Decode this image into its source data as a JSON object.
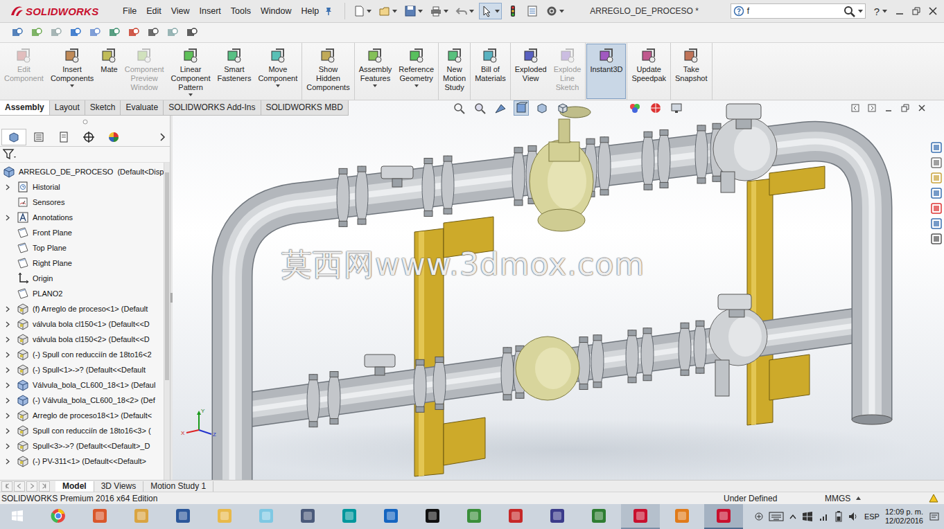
{
  "app": {
    "logo": "SOLIDWORKS",
    "title": "ARREGLO_DE_PROCESO *",
    "search_value": "f",
    "help": "?"
  },
  "menu": [
    "File",
    "Edit",
    "View",
    "Insert",
    "Tools",
    "Window",
    "Help"
  ],
  "quick_access_tools": [
    {
      "selected": false,
      "dropdown": true
    },
    {
      "selected": false,
      "dropdown": true
    },
    {
      "selected": false,
      "dropdown": true
    },
    {
      "selected": false,
      "dropdown": true
    },
    {
      "selected": false,
      "dropdown": true
    },
    {
      "selected": true,
      "dropdown": true
    },
    {
      "selected": false,
      "dropdown": false
    },
    {
      "selected": false,
      "dropdown": false
    },
    {
      "selected": false,
      "dropdown": true
    }
  ],
  "command_groups": [
    [
      {
        "lines": [
          "Edit",
          "Component"
        ],
        "disabled": true,
        "dropdown": false,
        "selected": false
      },
      {
        "lines": [
          "Insert",
          "Components"
        ],
        "disabled": false,
        "dropdown": true,
        "selected": false
      },
      {
        "lines": [
          "Mate"
        ],
        "disabled": false,
        "dropdown": false,
        "selected": false
      },
      {
        "lines": [
          "Component",
          "Preview",
          "Window"
        ],
        "disabled": true,
        "dropdown": false,
        "selected": false
      },
      {
        "lines": [
          "Linear",
          "Component",
          "Pattern"
        ],
        "disabled": false,
        "dropdown": true,
        "selected": false
      },
      {
        "lines": [
          "Smart",
          "Fasteners"
        ],
        "disabled": false,
        "dropdown": false,
        "selected": false
      },
      {
        "lines": [
          "Move",
          "Component"
        ],
        "disabled": false,
        "dropdown": true,
        "selected": false
      }
    ],
    [
      {
        "lines": [
          "Show",
          "Hidden",
          "Components"
        ],
        "disabled": false,
        "dropdown": false,
        "selected": false
      }
    ],
    [
      {
        "lines": [
          "Assembly",
          "Features"
        ],
        "disabled": false,
        "dropdown": true,
        "selected": false
      },
      {
        "lines": [
          "Reference",
          "Geometry"
        ],
        "disabled": false,
        "dropdown": true,
        "selected": false
      }
    ],
    [
      {
        "lines": [
          "New",
          "Motion",
          "Study"
        ],
        "disabled": false,
        "dropdown": false,
        "selected": false
      }
    ],
    [
      {
        "lines": [
          "Bill of",
          "Materials"
        ],
        "disabled": false,
        "dropdown": false,
        "selected": false
      }
    ],
    [
      {
        "lines": [
          "Exploded",
          "View"
        ],
        "disabled": false,
        "dropdown": false,
        "selected": false
      },
      {
        "lines": [
          "Explode",
          "Line",
          "Sketch"
        ],
        "disabled": true,
        "dropdown": false,
        "selected": false
      }
    ],
    [
      {
        "lines": [
          "Instant3D"
        ],
        "disabled": false,
        "dropdown": false,
        "selected": true
      }
    ],
    [
      {
        "lines": [
          "Update",
          "Speedpak"
        ],
        "disabled": false,
        "dropdown": false,
        "selected": false
      }
    ],
    [
      {
        "lines": [
          "Take",
          "Snapshot"
        ],
        "disabled": false,
        "dropdown": false,
        "selected": false
      }
    ]
  ],
  "tabs": [
    {
      "label": "Assembly",
      "selected": true
    },
    {
      "label": "Layout",
      "selected": false
    },
    {
      "label": "Sketch",
      "selected": false
    },
    {
      "label": "Evaluate",
      "selected": false
    },
    {
      "label": "SOLIDWORKS Add-Ins",
      "selected": false
    },
    {
      "label": "SOLIDWORKS MBD",
      "selected": false
    }
  ],
  "view_tools": [
    {
      "selected": false
    },
    {
      "selected": false
    },
    {
      "selected": false
    },
    {
      "selected": true
    },
    {
      "selected": false
    },
    {
      "selected": false
    },
    {
      "selected": false
    },
    {
      "selected": false
    },
    {
      "selected": false
    }
  ],
  "feature_manager_tabs": [
    {
      "selected": true
    },
    {
      "selected": false
    },
    {
      "selected": false
    },
    {
      "selected": false
    },
    {
      "selected": false
    }
  ],
  "tree": {
    "root": "ARREGLO_DE_PROCESO  (Default<Disp",
    "items": [
      {
        "label": "Historial",
        "kind": "history",
        "expandable": true
      },
      {
        "label": "Sensores",
        "kind": "sensor",
        "expandable": false
      },
      {
        "label": "Annotations",
        "kind": "annotation",
        "expandable": true
      },
      {
        "label": "Front Plane",
        "kind": "plane",
        "expandable": false
      },
      {
        "label": "Top Plane",
        "kind": "plane",
        "expandable": false
      },
      {
        "label": "Right Plane",
        "kind": "plane",
        "expandable": false
      },
      {
        "label": "Origin",
        "kind": "origin",
        "expandable": false
      },
      {
        "label": "PLANO2",
        "kind": "plane",
        "expandable": false
      },
      {
        "label": "(f) Arreglo de proceso<1> (Default",
        "kind": "assembly",
        "expandable": true
      },
      {
        "label": "válvula bola cl150<1> (Default<<D",
        "kind": "assembly",
        "expandable": true
      },
      {
        "label": "válvula bola cl150<2> (Default<<D",
        "kind": "assembly",
        "expandable": true
      },
      {
        "label": "(-) Spull con reducciín de 18to16<2",
        "kind": "assembly",
        "expandable": true
      },
      {
        "label": "(-) Spull<1>->? (Default<<Default",
        "kind": "assembly",
        "expandable": true
      },
      {
        "label": "Válvula_bola_CL600_18<1> (Defaul",
        "kind": "part",
        "expandable": true
      },
      {
        "label": "(-) Válvula_bola_CL600_18<2> (Def",
        "kind": "part",
        "expandable": true
      },
      {
        "label": "Arreglo de proceso18<1> (Default<",
        "kind": "assembly",
        "expandable": true
      },
      {
        "label": "Spull con reducciín de 18to16<3> (",
        "kind": "assembly",
        "expandable": true
      },
      {
        "label": "Spull<3>->? (Default<<Default>_D",
        "kind": "assembly",
        "expandable": true
      },
      {
        "label": "(-) PV-311<1> (Default<<Default>",
        "kind": "assembly",
        "expandable": true
      }
    ]
  },
  "graphics": {
    "watermark": "莫西网www.3dmox.com",
    "triad": {
      "x": "X",
      "y": "Y",
      "z": "Z"
    }
  },
  "bottom_tabs": [
    {
      "label": "Model",
      "selected": true
    },
    {
      "label": "3D Views",
      "selected": false
    },
    {
      "label": "Motion Study 1",
      "selected": false
    }
  ],
  "status_bar": {
    "edition": "SOLIDWORKS Premium 2016 x64 Edition",
    "state": "Under Defined",
    "units": "MMGS"
  },
  "taskbar": {
    "apps": [
      {
        "running": false,
        "selected": false
      },
      {
        "running": false,
        "selected": false
      },
      {
        "running": false,
        "selected": false
      },
      {
        "running": false,
        "selected": false
      },
      {
        "running": false,
        "selected": false
      },
      {
        "running": false,
        "selected": false
      },
      {
        "running": false,
        "selected": false
      },
      {
        "running": false,
        "selected": false
      },
      {
        "running": false,
        "selected": false
      },
      {
        "running": false,
        "selected": false
      },
      {
        "running": false,
        "selected": false
      },
      {
        "running": false,
        "selected": false
      },
      {
        "running": false,
        "selected": false
      },
      {
        "running": false,
        "selected": false
      },
      {
        "running": true,
        "selected": false
      },
      {
        "running": false,
        "selected": false
      },
      {
        "running": true,
        "selected": true
      }
    ],
    "lang": "ESP",
    "time": "12:09 p. m.",
    "date": "12/02/2016"
  }
}
